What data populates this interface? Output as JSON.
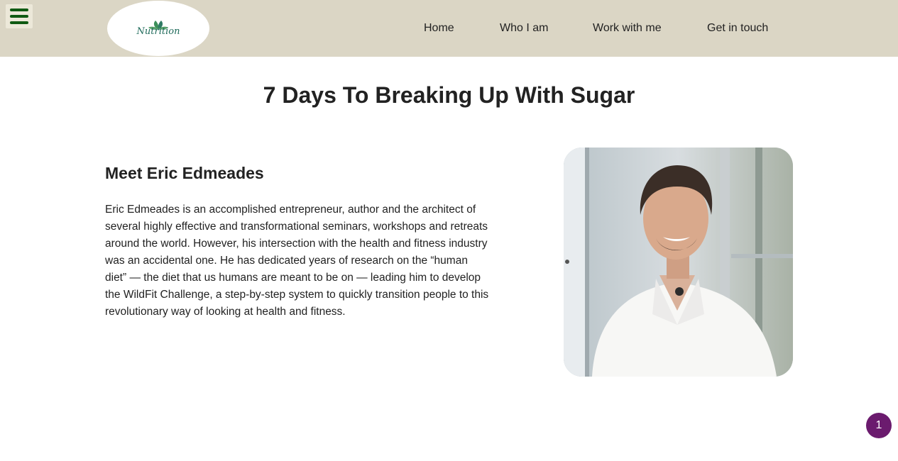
{
  "header": {
    "menu_icon": "hamburger-menu-icon",
    "logo_text": "Nutrition",
    "nav": [
      "Home",
      "Who I am",
      "Work with me",
      "Get in touch"
    ]
  },
  "page": {
    "title": "7 Days To Breaking Up With Sugar"
  },
  "about": {
    "heading": "Meet Eric Edmeades",
    "body": "Eric Edmeades is an accomplished entrepreneur, author and the architect of several highly effective and transformational seminars, workshops and retreats around the world. However, his intersection with the health and fitness industry was an accidental one. He has dedicated years of research on the “human diet” — the diet that us humans are meant to be on — leading him to develop the WildFit Challenge, a step-by-step system to quickly transition people to this revolutionary way of looking at health and fitness.",
    "photo_subject": "portrait of Eric Edmeades"
  },
  "badge": {
    "count": "1"
  },
  "colors": {
    "header_bg": "#dbd6c5",
    "menu_icon": "#0f5a12",
    "badge_bg": "#6b1b6e"
  }
}
